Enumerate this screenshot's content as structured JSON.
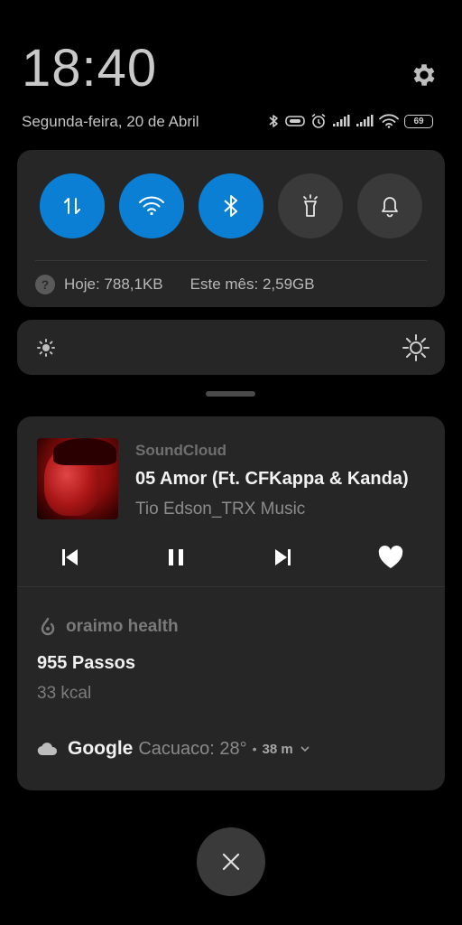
{
  "header": {
    "time": "18:40",
    "date": "Segunda-feira, 20 de Abril",
    "battery": "69"
  },
  "status_icons": [
    "bluetooth-icon",
    "vibrate-icon",
    "alarm-icon",
    "signal-icon",
    "signal-icon",
    "wifi-icon",
    "battery-icon"
  ],
  "quick_settings": {
    "toggles": [
      {
        "name": "mobile-data",
        "active": true
      },
      {
        "name": "wifi",
        "active": true
      },
      {
        "name": "bluetooth",
        "active": true
      },
      {
        "name": "flashlight",
        "active": false
      },
      {
        "name": "notifications",
        "active": false
      }
    ],
    "data_today": "Hoje: 788,1KB",
    "data_month": "Este mês: 2,59GB"
  },
  "media_notification": {
    "app": "SoundCloud",
    "title": "05 Amor (Ft. CFKappa & Kanda)",
    "artist": "Tio Edson_TRX Music"
  },
  "health_notification": {
    "app": "oraimo health",
    "steps": "955 Passos",
    "calories": "33 kcal"
  },
  "weather": {
    "source": "Google",
    "location_temp": "Cacuaco: 28°",
    "separator": "•",
    "elapsed": "38 m"
  },
  "colors": {
    "accent": "#0b7fd4",
    "card": "#262626",
    "background": "#000000"
  }
}
